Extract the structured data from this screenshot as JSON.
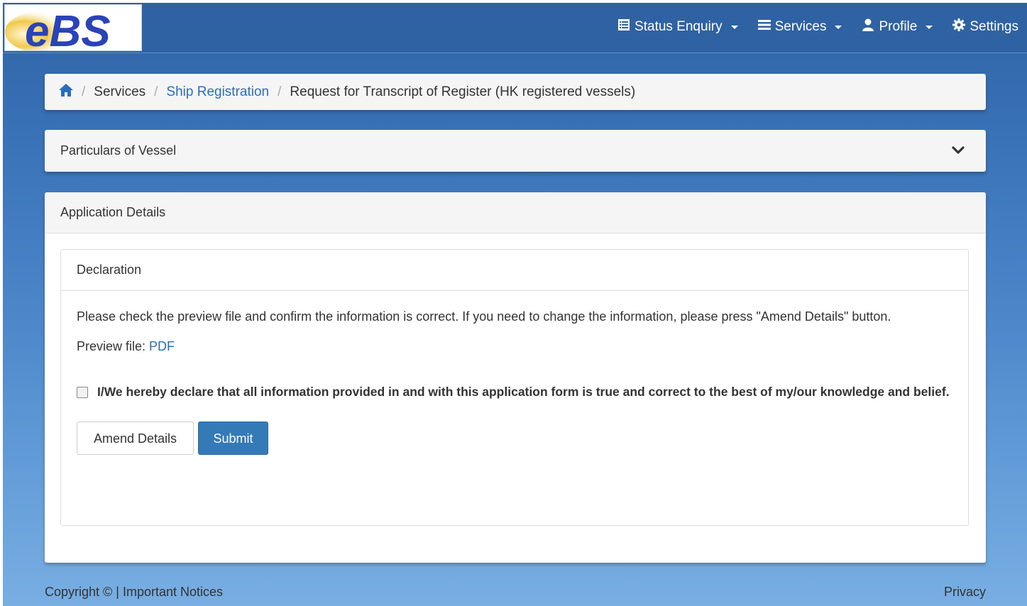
{
  "navbar": {
    "logo_text": "eBS",
    "items": [
      {
        "label": "Status Enquiry",
        "icon": "list-alt-icon"
      },
      {
        "label": "Services",
        "icon": "menu-hamburger-icon"
      },
      {
        "label": "Profile",
        "icon": "user-icon"
      },
      {
        "label": "Settings",
        "icon": "cog-icon"
      }
    ]
  },
  "breadcrumb": {
    "home_icon": "home-icon",
    "separator": "/",
    "items": [
      "Services",
      "Ship Registration",
      "Request for Transcript of Register (HK registered vessels)"
    ]
  },
  "particulars": {
    "title": "Particulars of Vessel",
    "icon": "chevron-down-icon"
  },
  "application": {
    "title": "Application Details",
    "declaration": {
      "title": "Declaration",
      "instruction": "Please check the preview file and confirm the information is correct. If you need to change the information, please press \"Amend Details\" button.",
      "preview_label": "Preview file:",
      "preview_link": "PDF",
      "checkbox_label": "I/We hereby declare that all information provided in and with this application form is true and correct to the best of my/our knowledge and belief.",
      "checked": false,
      "amend_button": "Amend Details",
      "submit_button": "Submit"
    }
  },
  "footer": {
    "left": "Copyright © | Important Notices",
    "right": "Privacy"
  },
  "colors": {
    "navbar": "#2e62a3",
    "link": "#2a6dbb",
    "primary_button": "#337ab7"
  }
}
